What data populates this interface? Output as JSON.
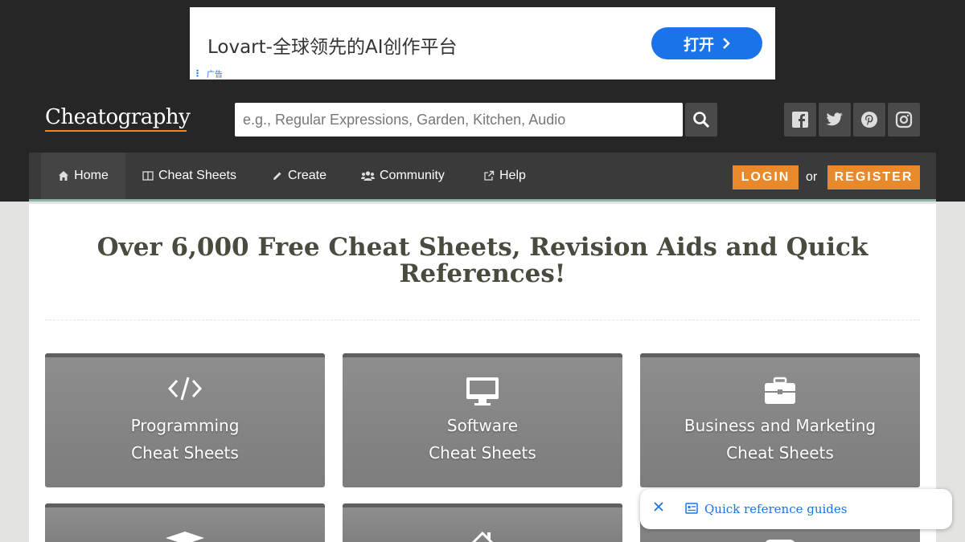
{
  "ad": {
    "title": "Lovart-全球领先的AI创作平台",
    "button_label": "打开",
    "badge": "广告"
  },
  "header": {
    "logo": "Cheatography",
    "search_placeholder": "e.g., Regular Expressions, Garden, Kitchen, Audio",
    "social_icons": [
      "facebook-icon",
      "twitter-icon",
      "pinterest-icon",
      "instagram-icon"
    ]
  },
  "nav": {
    "items": [
      {
        "label": "Home",
        "icon": "home-icon",
        "active": true
      },
      {
        "label": "Cheat Sheets",
        "icon": "book-icon"
      },
      {
        "label": "Create",
        "icon": "pencil-icon"
      },
      {
        "label": "Community",
        "icon": "users-icon"
      },
      {
        "label": "Help",
        "icon": "external-link-icon"
      }
    ],
    "login_label": "LOGIN",
    "or_text": "or",
    "register_label": "REGISTER"
  },
  "main": {
    "headline": "Over 6,000 Free Cheat Sheets, Revision Aids and Quick References!",
    "categories": [
      {
        "line1": "Programming",
        "line2": "Cheat Sheets",
        "icon": "code-icon"
      },
      {
        "line1": "Software",
        "line2": "Cheat Sheets",
        "icon": "monitor-icon"
      },
      {
        "line1": "Business and Marketing",
        "line2": "Cheat Sheets",
        "icon": "briefcase-icon"
      }
    ],
    "categories_row2_icons": [
      "graduation-cap-icon",
      "house-icon",
      "gamepad-icon"
    ]
  },
  "popup": {
    "text": "Quick reference guides"
  },
  "colors": {
    "accent_orange": "#e8892b",
    "dark_band": "#262626",
    "nav_bg": "#3a3a3a",
    "link_blue": "#1a73e8"
  }
}
